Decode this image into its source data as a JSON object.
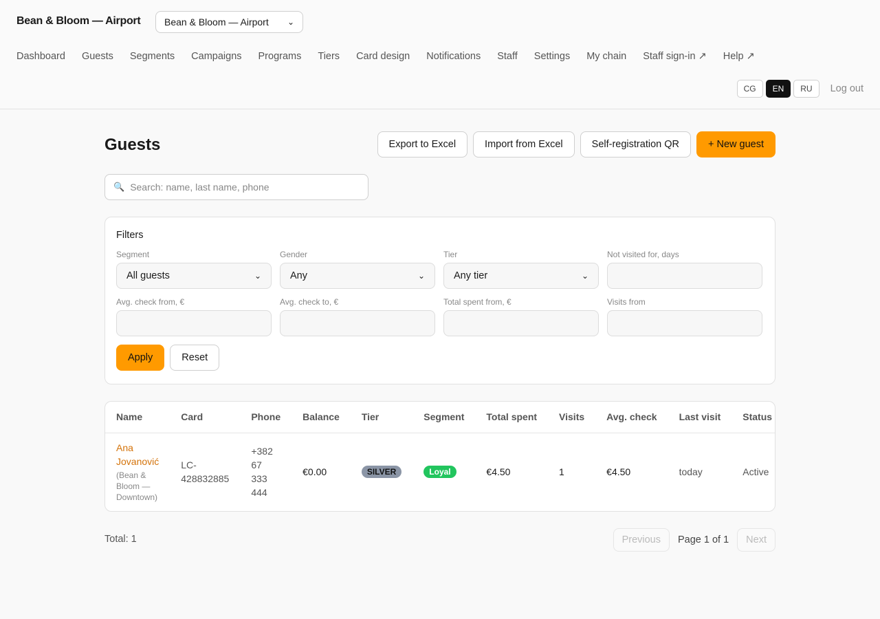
{
  "header": {
    "brand": "Bean & Bloom — Airport",
    "venue_select": "Bean & Bloom — Airport",
    "nav": [
      "Dashboard",
      "Guests",
      "Segments",
      "Campaigns",
      "Programs",
      "Tiers",
      "Card design",
      "Notifications",
      "Staff",
      "Settings",
      "My chain",
      "Staff sign-in ↗",
      "Help ↗"
    ],
    "languages": [
      "CG",
      "EN",
      "RU"
    ],
    "active_language": "EN",
    "logout": "Log out"
  },
  "page": {
    "title": "Guests",
    "actions": {
      "export": "Export to Excel",
      "import": "Import from Excel",
      "qr": "Self-registration QR",
      "new": "+ New guest"
    },
    "search_placeholder": "Search: name, last name, phone"
  },
  "filters": {
    "title": "Filters",
    "segment_label": "Segment",
    "segment_value": "All guests",
    "gender_label": "Gender",
    "gender_value": "Any",
    "tier_label": "Tier",
    "tier_value": "Any tier",
    "not_visited_label": "Not visited for, days",
    "avg_from_label": "Avg. check from, €",
    "avg_to_label": "Avg. check to, €",
    "total_from_label": "Total spent from, €",
    "visits_from_label": "Visits from",
    "apply": "Apply",
    "reset": "Reset"
  },
  "table": {
    "columns": [
      "Name",
      "Card",
      "Phone",
      "Balance",
      "Tier",
      "Segment",
      "Total spent",
      "Visits",
      "Avg. check",
      "Last visit",
      "Status"
    ],
    "rows": [
      {
        "name_line1": "Ana",
        "name_line2": "Jovanović",
        "venue_line1": "(Bean &",
        "venue_line2": "Bloom —",
        "venue_line3": "Downtown)",
        "card_line1": "LC-",
        "card_line2": "428832885",
        "phone_line1": "+382",
        "phone_line2": "67",
        "phone_line3": "333",
        "phone_line4": "444",
        "balance": "€0.00",
        "tier": "SILVER",
        "segment": "Loyal",
        "total_spent": "€4.50",
        "visits": "1",
        "avg_check": "€4.50",
        "last_visit": "today",
        "status": "Active"
      }
    ]
  },
  "footer": {
    "total": "Total: 1",
    "previous": "Previous",
    "page": "Page 1 of 1",
    "next": "Next"
  },
  "colors": {
    "accent": "#ff9a00",
    "link": "#d4730a",
    "segment_badge": "#22c55e",
    "tier_badge": "#8b95a6"
  }
}
